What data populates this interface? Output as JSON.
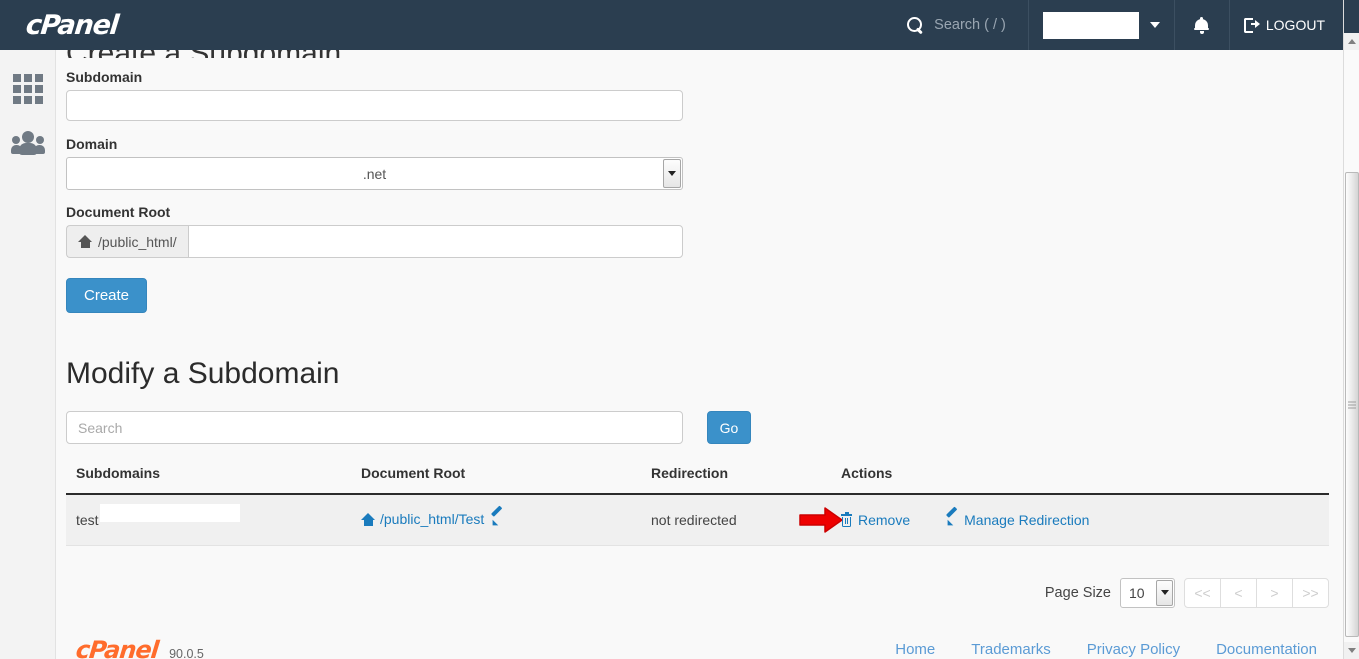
{
  "topbar": {
    "brand": "cPanel",
    "search_placeholder": "Search ( / )",
    "user_value": "",
    "logout_label": "LOGOUT",
    "icons": {
      "search": "search-icon",
      "caret": "chevron-down-icon",
      "bell": "bell-icon",
      "logout": "sign-out-icon"
    }
  },
  "sidebar": {
    "items": [
      {
        "name": "apps-grid",
        "icon": "grid-icon"
      },
      {
        "name": "user-manager",
        "icon": "users-icon"
      }
    ]
  },
  "create_section": {
    "heading": "Create a Subdomain",
    "subdomain_label": "Subdomain",
    "subdomain_value": "",
    "subdomain_placeholder": "",
    "domain_label": "Domain",
    "domain_value": ".net",
    "docroot_label": "Document Root",
    "docroot_prefix": "/public_html/",
    "docroot_value": "",
    "docroot_placeholder": "",
    "create_button": "Create"
  },
  "modify_section": {
    "title": "Modify a Subdomain",
    "search_placeholder": "Search",
    "search_value": "",
    "go_button": "Go",
    "columns": [
      "Subdomains",
      "Document Root",
      "Redirection",
      "Actions"
    ],
    "rows": [
      {
        "subdomain": "test",
        "document_root": "/public_html/Test",
        "redirection": "not redirected",
        "actions": {
          "remove": "Remove",
          "manage_redirection": "Manage Redirection"
        }
      }
    ]
  },
  "pagination": {
    "page_size_label": "Page Size",
    "page_size_value": "10",
    "first": "<<",
    "prev": "<",
    "next": ">",
    "last": ">>"
  },
  "footer": {
    "logo": "cPanel",
    "version": "90.0.5",
    "links": [
      "Home",
      "Trademarks",
      "Privacy Policy",
      "Documentation"
    ]
  },
  "annotation": {
    "type": "red-arrow",
    "points_at": "Remove",
    "color": "#ee0000"
  },
  "colors": {
    "topbar_bg": "#2b3e50",
    "primary": "#3b91ca",
    "link": "#1a7bbd",
    "footer_logo": "#ff6c2c",
    "annotation_red": "#ee0000"
  }
}
